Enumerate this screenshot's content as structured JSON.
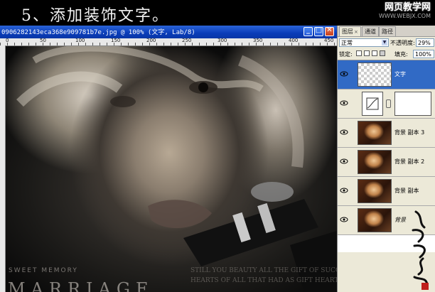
{
  "tutorial": {
    "title": "5、添加装饰文字。",
    "site_logo_line1": "网页教学网",
    "site_logo_line2": "WWW.WEBJX.COM"
  },
  "document": {
    "title": "0906282143eca368e909781b7e.jpg @ 100% (文字, Lab/8)",
    "minimize_glyph": "_",
    "maximize_glyph": "□",
    "close_glyph": "✕",
    "ruler_numbers": [
      "0",
      "50",
      "100",
      "150",
      "200",
      "250",
      "300",
      "350",
      "400",
      "450"
    ],
    "canvas_text_small": "SWEET MEMORY",
    "canvas_text_big": "MARRIAGE"
  },
  "layers_panel": {
    "tabs": [
      {
        "label": "图层",
        "active": true
      },
      {
        "label": "通道",
        "active": false
      },
      {
        "label": "路径",
        "active": false
      }
    ],
    "blend_mode": "正常",
    "opacity_label": "不透明度:",
    "opacity_value": "29%",
    "lock_label": "锁定:",
    "fill_label": "填充:",
    "fill_value": "100%",
    "layers": [
      {
        "name": "文字",
        "type": "text",
        "active": true
      },
      {
        "name": "",
        "type": "adjustment",
        "active": false
      },
      {
        "name": "背景 副本 3",
        "type": "photo",
        "active": false
      },
      {
        "name": "背景 副本 2",
        "type": "photo",
        "active": false
      },
      {
        "name": "背景 副本",
        "type": "photo",
        "active": false
      },
      {
        "name": "背景",
        "type": "photo",
        "active": false
      }
    ]
  },
  "colors": {
    "titlebar": "#0a3cb8",
    "active_layer": "#316ac5",
    "panel_bg": "#ece9d8"
  }
}
